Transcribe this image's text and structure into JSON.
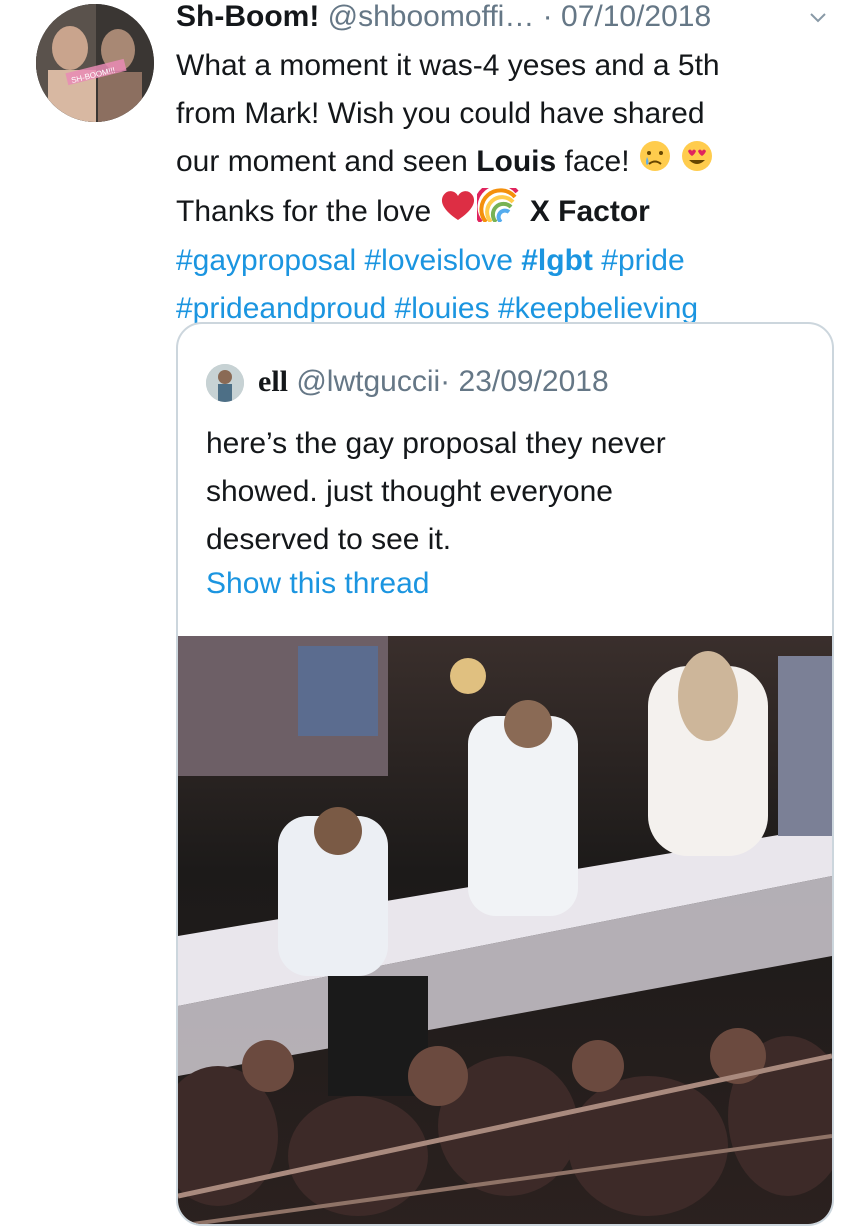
{
  "tweet": {
    "display_name": "Sh-Boom!",
    "handle": "@shboomoffi…",
    "separator": "·",
    "date": "07/10/2018",
    "avatar_text": "SH-BOOM!!!",
    "line1": "What a moment it was-4 yeses and a 5th",
    "line2": "from Mark! Wish you could have shared",
    "line3_a": "our moment and seen ",
    "line3_bold": "Louis",
    "line3_b": " face! ",
    "line4_a": "Thanks for the love ",
    "line4_bold": "X Factor",
    "hashtags": {
      "h1": "#gayproposal",
      "h2": "#loveislove",
      "h3": "#lgbt",
      "h4": "#pride",
      "h5": "#prideandproud",
      "h6": "#louies",
      "h7": "#keepbelieving"
    },
    "icons": [
      "avatar",
      "chevron-down-icon",
      "crying-face-emoji",
      "heart-eyes-emoji",
      "red-heart-emoji",
      "rainbow-emoji"
    ]
  },
  "quoted": {
    "display_name": "ell",
    "handle": "@lwtguccii",
    "separator": "·",
    "date": "23/09/2018",
    "line1": "here’s the gay proposal they never",
    "line2": "showed. just thought everyone",
    "line3": "deserved to see it.",
    "show_thread": "Show this thread"
  },
  "colors": {
    "link": "#1b95e0",
    "meta": "#657786",
    "border": "#ccd6dd"
  }
}
